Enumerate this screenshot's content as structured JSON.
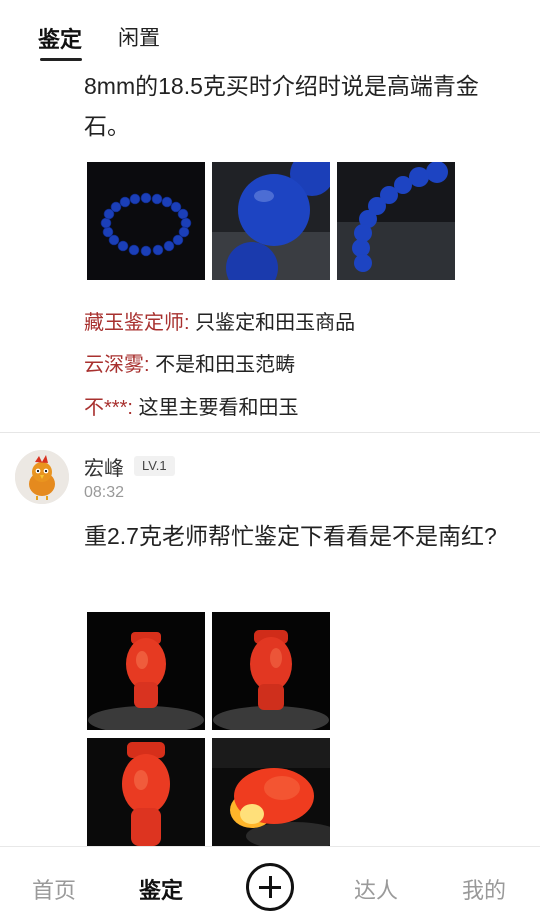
{
  "top_tabs": {
    "active": "鉴定",
    "other": "闲置"
  },
  "post1": {
    "text": "8mm的18.5克买时介绍时说是高端青金石。",
    "images": [
      "lapis-bracelet-photo",
      "lapis-bead-closeup-photo",
      "lapis-bead-strand-photo"
    ],
    "comments": [
      {
        "author": "藏玉鉴定师:",
        "text": " 只鉴定和田玉商品"
      },
      {
        "author": "云深雾:",
        "text": " 不是和田玉范畴"
      },
      {
        "author": "不***:",
        "text": " 这里主要看和田玉"
      }
    ]
  },
  "post2": {
    "username": "宏峰",
    "level": "LV.1",
    "time": "08:32",
    "text": "重2.7克老师帮忙鉴定下看看是不是南红?",
    "images": [
      "red-carving-front-photo",
      "red-carving-side-photo",
      "red-carving-closeup-photo",
      "red-carving-backlit-photo"
    ]
  },
  "bottom_nav": {
    "home": "首页",
    "appraise": "鉴定",
    "add_icon": "plus-circle-icon",
    "experts": "达人",
    "mine": "我的"
  },
  "colors": {
    "comment_author": "#a8312f",
    "lapis": "#1b3fb8",
    "carnelian": "#e33a22"
  }
}
